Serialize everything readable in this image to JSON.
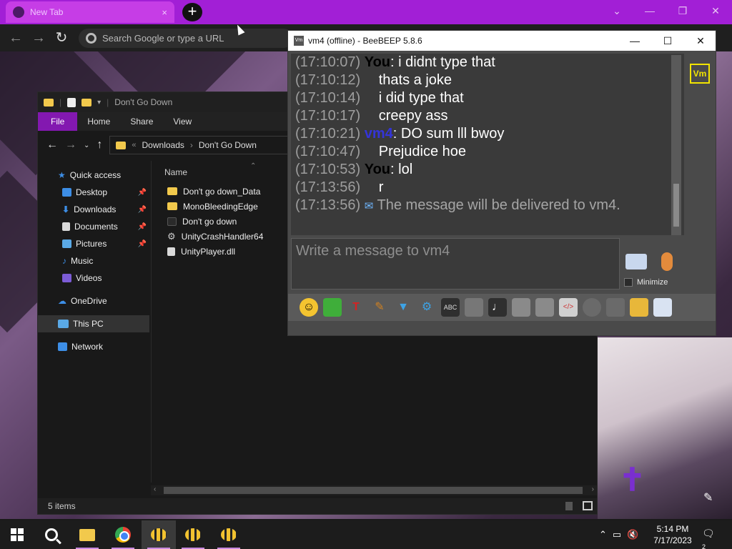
{
  "chrome": {
    "tab_title": "New Tab",
    "tab_close": "×",
    "new_tab": "+",
    "omnibox_placeholder": "Search Google or type a URL",
    "controls": {
      "tab_search": "⌄",
      "minimize": "—",
      "restore": "❐",
      "close": "✕"
    }
  },
  "explorer": {
    "title": "Don't Go Down",
    "ribbon_tabs": [
      "File",
      "Home",
      "Share",
      "View"
    ],
    "breadcrumb": [
      "Downloads",
      "Don't Go Down"
    ],
    "breadcrumb_sep": "›",
    "sidebar": [
      {
        "label": "Quick access",
        "icon": "star-icon",
        "pinned": false
      },
      {
        "label": "Desktop",
        "icon": "desktop-icon",
        "pinned": true
      },
      {
        "label": "Downloads",
        "icon": "download-icon",
        "pinned": true
      },
      {
        "label": "Documents",
        "icon": "document-icon",
        "pinned": true
      },
      {
        "label": "Pictures",
        "icon": "picture-icon",
        "pinned": true
      },
      {
        "label": "Music",
        "icon": "music-icon",
        "pinned": false
      },
      {
        "label": "Videos",
        "icon": "video-icon",
        "pinned": false
      },
      {
        "label": "OneDrive",
        "icon": "cloud-icon",
        "pinned": false
      },
      {
        "label": "This PC",
        "icon": "pc-icon",
        "pinned": false
      },
      {
        "label": "Network",
        "icon": "network-icon",
        "pinned": false
      }
    ],
    "column_name": "Name",
    "files": [
      {
        "name": "Don't go down_Data",
        "icon": "folder-icon"
      },
      {
        "name": "MonoBleedingEdge",
        "icon": "folder-icon"
      },
      {
        "name": "Don't go down",
        "icon": "exe-icon"
      },
      {
        "name": "UnityCrashHandler64",
        "icon": "gear-icon"
      },
      {
        "name": "UnityPlayer.dll",
        "icon": "dll-icon"
      }
    ],
    "status": "5 items"
  },
  "beebeep": {
    "title": "vm4 (offline) - BeeBEEP 5.8.6",
    "title_badge": "Vm",
    "controls": {
      "minimize": "—",
      "maximize": "☐",
      "close": "✕"
    },
    "messages": [
      {
        "time": "(17:10:07)",
        "sender": "You",
        "sender_type": "you",
        "text": "i didnt type that"
      },
      {
        "time": "(17:10:12)",
        "sender": "",
        "sender_type": "cont",
        "text": "thats a joke"
      },
      {
        "time": "(17:10:14)",
        "sender": "",
        "sender_type": "cont",
        "text": "i did type that"
      },
      {
        "time": "(17:10:17)",
        "sender": "",
        "sender_type": "cont",
        "text": "creepy ass"
      },
      {
        "time": "(17:10:21)",
        "sender": "vm4",
        "sender_type": "vm",
        "text": "DO sum lll bwoy"
      },
      {
        "time": "(17:10:47)",
        "sender": "",
        "sender_type": "cont",
        "text": "Prejudice hoe"
      },
      {
        "time": "(17:10:53)",
        "sender": "You",
        "sender_type": "you",
        "text": "lol"
      },
      {
        "time": "(17:13:56)",
        "sender": "",
        "sender_type": "cont",
        "text": "r"
      },
      {
        "time": "(17:13:56)",
        "sender": "",
        "sender_type": "system",
        "text": "The message will be delivered to vm4."
      }
    ],
    "input_placeholder": "Write a message to vm4",
    "minimize_label": "Minimize",
    "user_badge": "Vm"
  },
  "taskbar": {
    "time": "5:14 PM",
    "date": "7/17/2023",
    "notification_count": "2"
  },
  "colors": {
    "chrome_tabbar": "#a21fd6",
    "explorer_file_tab": "#8318b0",
    "vm_sender": "#3434d8",
    "user_badge": "#f2e400"
  }
}
